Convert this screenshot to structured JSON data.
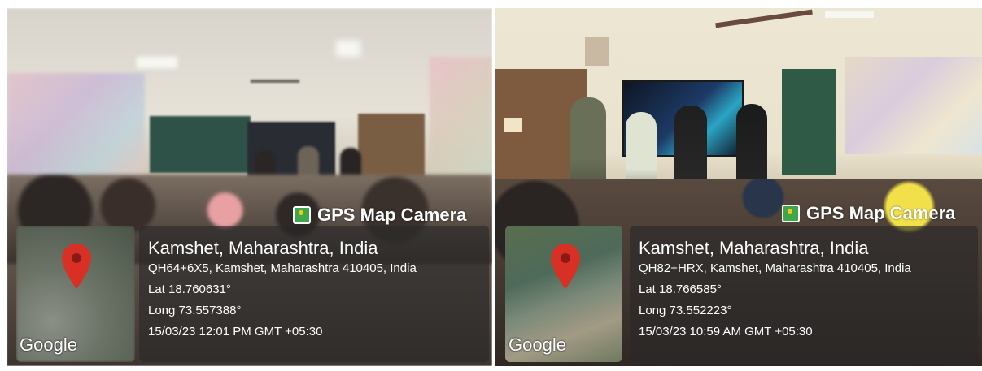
{
  "photos": [
    {
      "brand": "GPS Map Camera",
      "location": "Kamshet, Maharashtra, India",
      "address": "QH64+6X5, Kamshet, Maharashtra 410405, India",
      "lat": "Lat 18.760631°",
      "long": "Long 73.557388°",
      "datetime": "15/03/23 12:01 PM GMT +05:30",
      "map_credit": "Google"
    },
    {
      "brand": "GPS Map Camera",
      "location": "Kamshet, Maharashtra, India",
      "address": "QH82+HRX, Kamshet, Maharashtra 410405, India",
      "lat": "Lat 18.766585°",
      "long": "Long 73.552223°",
      "datetime": "15/03/23 10:59 AM GMT +05:30",
      "map_credit": "Google"
    }
  ],
  "icons": {
    "brand": "gps-map-camera-icon",
    "pin": "map-pin-icon"
  },
  "colors": {
    "pin": "#d93025",
    "overlay": "#282828"
  }
}
